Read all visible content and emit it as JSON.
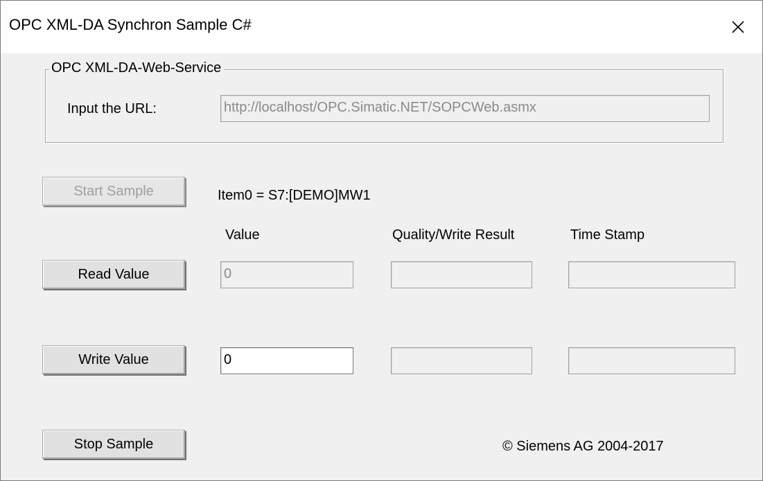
{
  "window": {
    "title": "OPC XML-DA Synchron Sample C#",
    "close_glyph": "✕"
  },
  "web_service": {
    "group_label": "OPC XML-DA-Web-Service",
    "url_label": "Input the URL:",
    "url_value": "http://localhost/OPC.Simatic.NET/SOPCWeb.asmx"
  },
  "buttons": {
    "start_sample": "Start Sample",
    "read_value": "Read Value",
    "write_value": "Write Value",
    "stop_sample": "Stop Sample"
  },
  "item": {
    "label": "Item0  =  S7:[DEMO]MW1"
  },
  "columns": {
    "value": "Value",
    "quality": "Quality/Write Result",
    "timestamp": "Time Stamp"
  },
  "read_row": {
    "value": "0",
    "quality": "",
    "timestamp": ""
  },
  "write_row": {
    "value": "0",
    "quality": "",
    "timestamp": ""
  },
  "footer": {
    "copyright": "© Siemens AG 2004-2017"
  },
  "icons": {
    "close": "close-icon"
  }
}
